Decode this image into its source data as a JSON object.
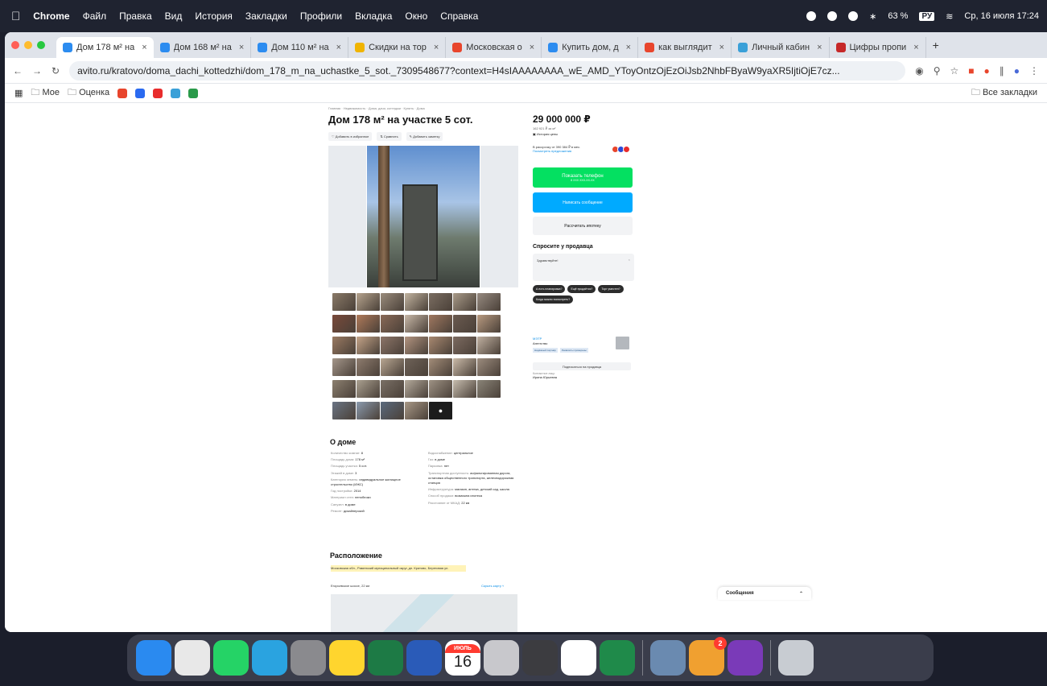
{
  "menubar": {
    "app": "Chrome",
    "items": [
      "Файл",
      "Правка",
      "Вид",
      "История",
      "Закладки",
      "Профили",
      "Вкладка",
      "Окно",
      "Справка"
    ],
    "battery": "63 %",
    "lang": "РУ",
    "datetime": "Ср, 16 июля 17:24"
  },
  "tabs": [
    {
      "label": "Дом 178 м² на",
      "color": "#2c8cf0",
      "active": true
    },
    {
      "label": "Дом 168 м² на",
      "color": "#2c8cf0",
      "active": false
    },
    {
      "label": "Дом 110 м² на",
      "color": "#2c8cf0",
      "active": false
    },
    {
      "label": "Скидки на тор",
      "color": "#f0b400",
      "active": false
    },
    {
      "label": "Московская о",
      "color": "#e8452c",
      "active": false
    },
    {
      "label": "Купить дом, д",
      "color": "#2c8cf0",
      "active": false
    },
    {
      "label": "как выглядит",
      "color": "#e8452c",
      "active": false
    },
    {
      "label": "Личный кабин",
      "color": "#3aa0d8",
      "active": false
    },
    {
      "label": "Цифры пропи",
      "color": "#c62828",
      "active": false
    }
  ],
  "address": {
    "url": "avito.ru/kratovo/doma_dachi_kottedzhi/dom_178_m_na_uchastke_5_sot._7309548677?context=H4sIAAAAAAAA_wE_AMD_YToyOntzOjEzOiJsb2NhbFByaW9yaXR5IjtiOjE7cz..."
  },
  "bookmarks": {
    "items": [
      "Мое",
      "Оценка"
    ],
    "all": "Все закладки"
  },
  "listing": {
    "breadcrumbs": "Главная · Недвижимость · Дома, дачи, коттеджи · Купить · Дома",
    "title": "Дом 178 м² на участке 5 сот.",
    "actions": [
      "Добавить в избранное",
      "Сравнить",
      "Добавить заметку"
    ],
    "price": "29 000 000 ₽",
    "price_per_m2": "162 921 ₽ за м²",
    "price_history": "История цены",
    "installment": "В рассрочку от 390 384 ₽ в мес.",
    "installment_link": "Посмотреть предложения",
    "btn_phone": "Показать телефон",
    "btn_phone_sub": "8 XXX XXX-XX-XX",
    "btn_message": "Написать сообщение",
    "btn_mortgage": "Рассчитать ипотеку",
    "ask_title": "Спросите у продавца",
    "ask_text": "Здравствуйте!",
    "chips": [
      "А есть планировка?",
      "Ещё продаётся?",
      "Торг уместен?",
      "Когда можно посмотреть?"
    ],
    "seller_name": "МЭТР",
    "seller_type": "Агентство",
    "seller_tags": [
      "Надёжный партнёр",
      "Реквизиты проверены"
    ],
    "subscribe": "Подписаться на продавца",
    "contact_label": "Контактное лицо",
    "contact_name": "Ирина Юрьевна"
  },
  "about": {
    "title": "О доме",
    "left": [
      {
        "k": "Количество комнат:",
        "v": "8"
      },
      {
        "k": "Площадь дома:",
        "v": "178 м²"
      },
      {
        "k": "Площадь участка:",
        "v": "5 сот."
      },
      {
        "k": "Этажей в доме:",
        "v": "3"
      },
      {
        "k": "Категория земель:",
        "v": "индивидуальное жилищное строительство (ИЖС)"
      },
      {
        "k": "Год постройки:",
        "v": "2014"
      },
      {
        "k": "Материал стен:",
        "v": "пеноблоки"
      },
      {
        "k": "Санузел:",
        "v": "в доме"
      },
      {
        "k": "Ремонт:",
        "v": "дизайнерский"
      }
    ],
    "right": [
      {
        "k": "Водоснабжение:",
        "v": "центральное"
      },
      {
        "k": "Газ:",
        "v": "в доме"
      },
      {
        "k": "Парковка:",
        "v": "нет"
      },
      {
        "k": "Транспортная доступность:",
        "v": "асфальтированная дорога, остановка общественного транспорта, железнодорожная станция"
      },
      {
        "k": "Инфраструктура:",
        "v": "магазин, аптека, детский сад, школа"
      },
      {
        "k": "Способ продажи:",
        "v": "возможна ипотека"
      },
      {
        "k": "Расстояние от МКАД:",
        "v": "22 км"
      }
    ]
  },
  "location": {
    "title": "Расположение",
    "address": "Московская обл., Раменский муниципальный округ, дп. Кратово, Береговая ул.",
    "highway": "Егорьевское шоссе, 22 км",
    "show_map": "Скрыть карту"
  },
  "thumbnails": [
    "#8a7a68",
    "#b6a48e",
    "#9a8c7c",
    "#c2b4a0",
    "#7b6e62",
    "#a89a88",
    "#968a80",
    "#7a4a3a",
    "#b07a5a",
    "#8a6a58",
    "#c8b8a8",
    "#a07860",
    "#6a5a50",
    "#b89a80",
    "#9a7a62",
    "#c4a488",
    "#8c7468",
    "#b29480",
    "#a88870",
    "#7c6a60",
    "#c0b0a0",
    "#a4968a",
    "#8e7c6e",
    "#b8a692",
    "#6e6258",
    "#a28c78",
    "#cabaa8",
    "#9c8c7e",
    "#8c8070",
    "#aaa090",
    "#7a7066",
    "#b4aa9c",
    "#9e9284",
    "#c6bcae",
    "#8a8478",
    "#6a7484",
    "#8a9aae",
    "#5a6a7e",
    "#a89886"
  ],
  "messages_widget": "Сообщения",
  "dock": [
    {
      "name": "finder-icon",
      "color": "#2a8af0"
    },
    {
      "name": "chrome-icon",
      "color": "#e8e8e8"
    },
    {
      "name": "whatsapp-icon",
      "color": "#25d366"
    },
    {
      "name": "telegram-icon",
      "color": "#2aa3e0"
    },
    {
      "name": "system-settings-icon",
      "color": "#8a8a8e"
    },
    {
      "name": "notes-icon",
      "color": "#ffd52e"
    },
    {
      "name": "excel-icon",
      "color": "#1d7a45"
    },
    {
      "name": "word-icon",
      "color": "#2a5bb8"
    },
    {
      "name": "calendar-icon",
      "color": "#ffffff"
    },
    {
      "name": "launchpad-icon",
      "color": "#c8c8cc"
    },
    {
      "name": "iphone-mirroring-icon",
      "color": "#3c3c40"
    },
    {
      "name": "chatgpt-icon",
      "color": "#ffffff"
    },
    {
      "name": "duo-app-icon",
      "color": "#1f8a4a"
    },
    {
      "name": "preview-icon",
      "color": "#6a8ab0"
    },
    {
      "name": "app-store-icon",
      "color": "#f0a030"
    },
    {
      "name": "onenote-icon",
      "color": "#7a3ab8"
    },
    {
      "name": "trash-icon",
      "color": "#c8ccd2"
    }
  ],
  "calendar": {
    "month": "ИЮЛЬ",
    "day": "16"
  },
  "appstore_badge": "2"
}
